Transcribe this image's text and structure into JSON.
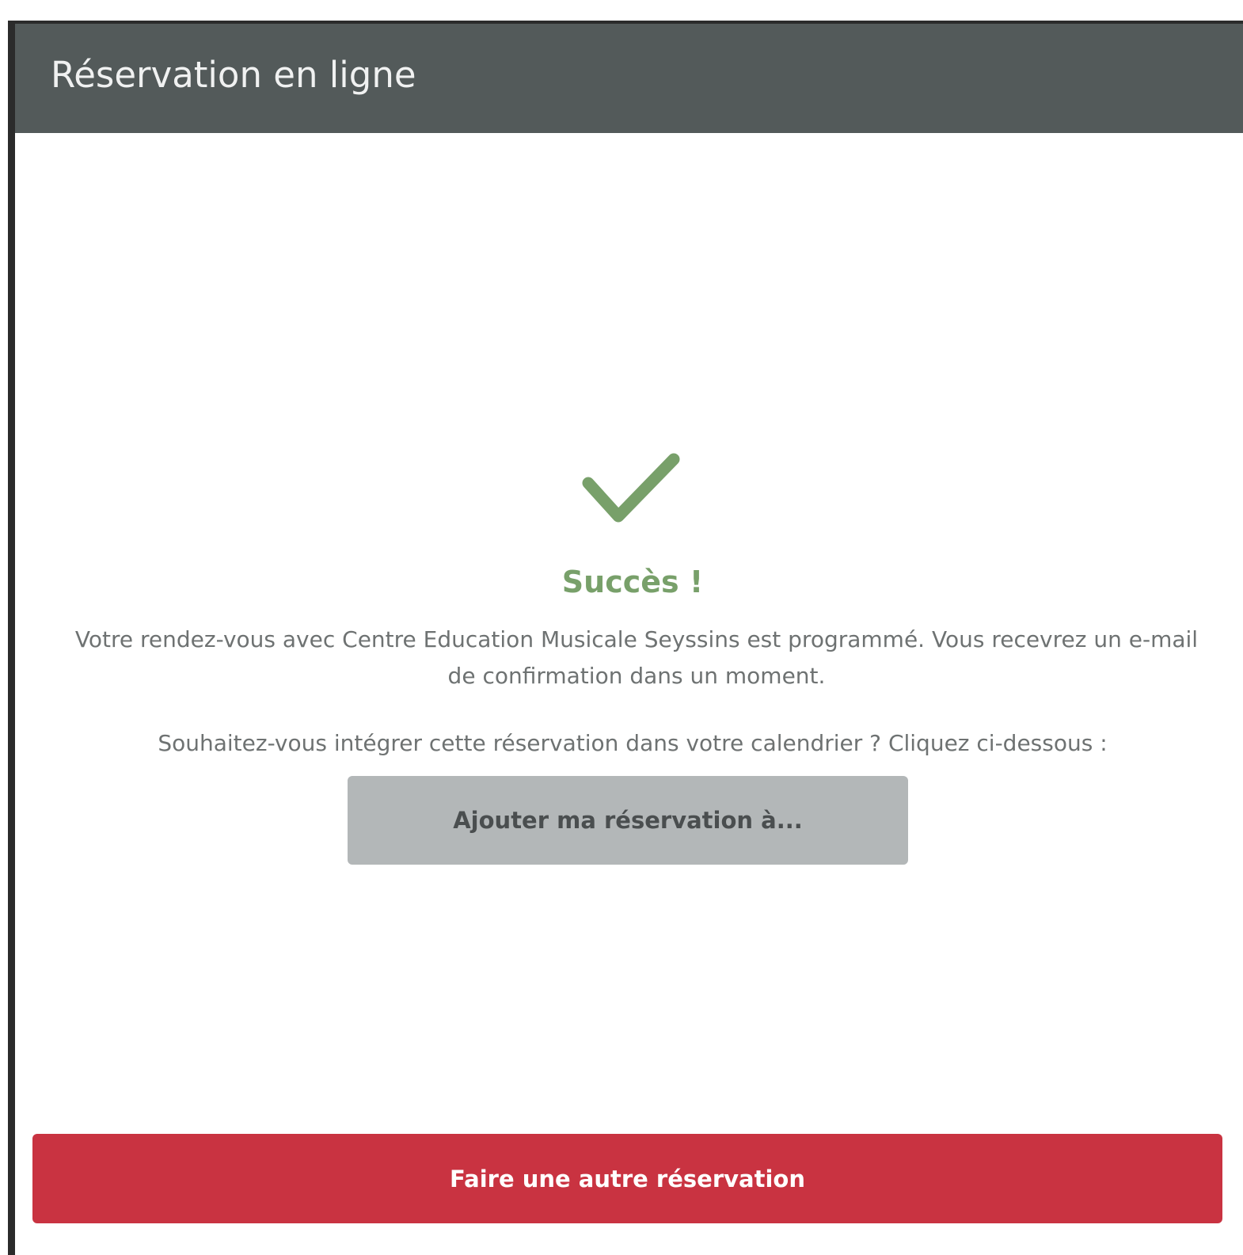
{
  "header": {
    "title": "Réservation en ligne"
  },
  "confirmation": {
    "icon": "checkmark-icon",
    "title": "Succès !",
    "message": "Votre rendez-vous avec Centre Education Musicale Seyssins est programmé. Vous recevrez un e-mail de confirmation dans un moment.",
    "calendar_question": "Souhaitez-vous intégrer cette réservation dans votre calendrier ? Cliquez ci-dessous :",
    "add_to_calendar_label": "Ajouter ma réservation à..."
  },
  "footer": {
    "new_booking_label": "Faire une autre réservation"
  },
  "colors": {
    "header_bg": "#535a5a",
    "success_green": "#78a06a",
    "primary_red": "#c93341",
    "secondary_gray": "#b3b7b8"
  }
}
